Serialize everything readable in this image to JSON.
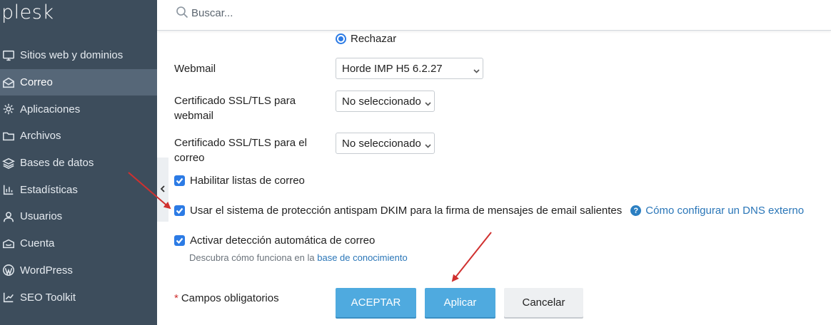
{
  "app": {
    "logo": "plesk"
  },
  "search": {
    "placeholder": "Buscar..."
  },
  "sidebar": {
    "items": [
      {
        "label": "Sitios web y dominios",
        "icon": "monitor-icon"
      },
      {
        "label": "Correo",
        "icon": "mail-icon",
        "active": true
      },
      {
        "label": "Aplicaciones",
        "icon": "gear-icon"
      },
      {
        "label": "Archivos",
        "icon": "folder-icon"
      },
      {
        "label": "Bases de datos",
        "icon": "layers-icon"
      },
      {
        "label": "Estadísticas",
        "icon": "bar-chart-icon"
      },
      {
        "label": "Usuarios",
        "icon": "user-icon"
      },
      {
        "label": "Cuenta",
        "icon": "account-icon"
      },
      {
        "label": "WordPress",
        "icon": "wordpress-icon"
      },
      {
        "label": "SEO Toolkit",
        "icon": "seo-icon"
      }
    ]
  },
  "form": {
    "radio_label": "Rechazar",
    "webmail": {
      "label": "Webmail",
      "value": "Horde IMP H5 6.2.27"
    },
    "ssl_webmail": {
      "label": "Certificado SSL/TLS para webmail",
      "value": "No seleccionado"
    },
    "ssl_mail": {
      "label": "Certificado SSL/TLS para el correo",
      "value": "No seleccionado"
    },
    "mailing_lists": {
      "label": "Habilitar listas de correo",
      "checked": true
    },
    "dkim": {
      "label": "Usar el sistema de protección antispam DKIM para la firma de mensajes de email salientes",
      "checked": true,
      "help_link": "Cómo configurar un DNS externo"
    },
    "autodiscover": {
      "label": "Activar detección automática de correo",
      "checked": true,
      "hint_prefix": "Descubra cómo funciona en la",
      "hint_link": "base de conocimiento"
    },
    "required_note": "Campos obligatorios"
  },
  "buttons": {
    "ok": "ACEPTAR",
    "apply": "Aplicar",
    "cancel": "Cancelar"
  },
  "colors": {
    "sidebar": "#3d4d5c",
    "sidebar_active": "#566778",
    "primary": "#4faadf",
    "accent": "#2c7be5",
    "annotation_arrow": "#d0302f"
  }
}
